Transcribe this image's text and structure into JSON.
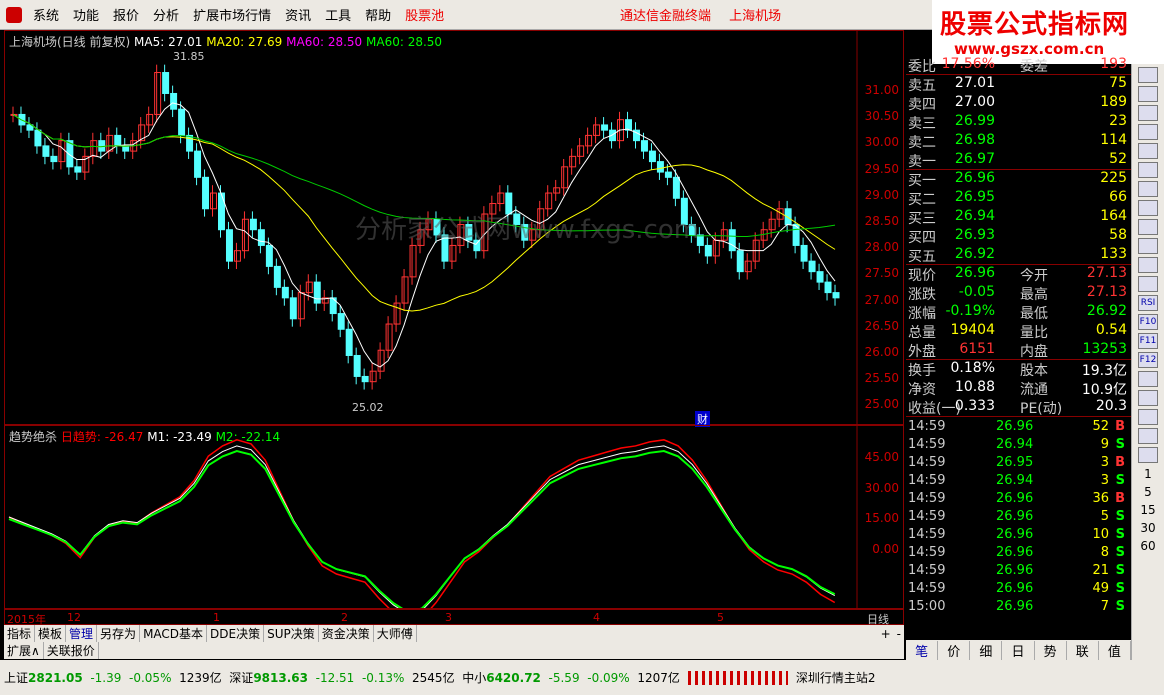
{
  "menu": {
    "items": [
      "系统",
      "功能",
      "报价",
      "分析",
      "扩展市场行情",
      "资讯",
      "工具",
      "帮助"
    ],
    "highlight": "股票池",
    "center_left": "通达信金融终端",
    "center_right": "上海机场"
  },
  "brand": {
    "name": "股票公式指标网",
    "url": "www.gszx.com.cn"
  },
  "chart_title": {
    "stock": "上海机场(日线 前复权)",
    "ma5": "MA5: 27.01",
    "ma20": "MA20: 27.69",
    "ma60a": "MA60: 28.50",
    "ma60b": "MA60: 28.50"
  },
  "price_ticks": [
    "31.00",
    "30.50",
    "30.00",
    "29.50",
    "29.00",
    "28.50",
    "28.00",
    "27.50",
    "27.00",
    "26.50",
    "26.00",
    "25.50",
    "25.00"
  ],
  "annotations": {
    "high": "31.85",
    "low": "25.02",
    "cai": "财"
  },
  "watermark": "分析家公式网www.fxgs.com",
  "indicator": {
    "name": "趋势绝杀",
    "ri": "日趋势: -26.47",
    "m1": "M1: -23.49",
    "m2": "M2: -22.14",
    "ticks": [
      "45.00",
      "30.00",
      "15.00",
      "0.00"
    ]
  },
  "dates": {
    "year": "2015年",
    "d12": "12",
    "d1": "1",
    "d2": "2",
    "d3": "3",
    "d4": "4",
    "d5": "5",
    "period": "日线"
  },
  "tabs1": [
    "指标",
    "模板",
    "管理",
    "另存为",
    "MACD基本",
    "DDE决策",
    "SUP决策",
    "资金决策",
    "大师傅"
  ],
  "tabs2": [
    "扩展∧",
    "关联报价"
  ],
  "quote": {
    "weibi": {
      "label": "委比",
      "value": "17.56%",
      "label2": "委差",
      "value2": "193"
    },
    "sell": [
      {
        "label": "卖五",
        "price": "27.01",
        "vol": "75"
      },
      {
        "label": "卖四",
        "price": "27.00",
        "vol": "189"
      },
      {
        "label": "卖三",
        "price": "26.99",
        "vol": "23"
      },
      {
        "label": "卖二",
        "price": "26.98",
        "vol": "114"
      },
      {
        "label": "卖一",
        "price": "26.97",
        "vol": "52"
      }
    ],
    "buy": [
      {
        "label": "买一",
        "price": "26.96",
        "vol": "225"
      },
      {
        "label": "买二",
        "price": "26.95",
        "vol": "66"
      },
      {
        "label": "买三",
        "price": "26.94",
        "vol": "164"
      },
      {
        "label": "买四",
        "price": "26.93",
        "vol": "58"
      },
      {
        "label": "买五",
        "price": "26.92",
        "vol": "133"
      }
    ],
    "stats": [
      {
        "l1": "现价",
        "v1": "26.96",
        "l2": "今开",
        "v2": "27.13"
      },
      {
        "l1": "涨跌",
        "v1": "-0.05",
        "l2": "最高",
        "v2": "27.13"
      },
      {
        "l1": "涨幅",
        "v1": "-0.19%",
        "l2": "最低",
        "v2": "26.92"
      },
      {
        "l1": "总量",
        "v1": "19404",
        "l2": "量比",
        "v2": "0.54"
      },
      {
        "l1": "外盘",
        "v1": "6151",
        "l2": "内盘",
        "v2": "13253"
      }
    ],
    "stats2": [
      {
        "l1": "换手",
        "v1": "0.18%",
        "l2": "股本",
        "v2": "19.3亿"
      },
      {
        "l1": "净资",
        "v1": "10.88",
        "l2": "流通",
        "v2": "10.9亿"
      },
      {
        "l1": "收益(一)",
        "v1": "0.333",
        "l2": "PE(动)",
        "v2": "20.3"
      }
    ],
    "ticks": [
      {
        "t": "14:59",
        "p": "26.96",
        "v": "52",
        "s": "B"
      },
      {
        "t": "14:59",
        "p": "26.94",
        "v": "9",
        "s": "S"
      },
      {
        "t": "14:59",
        "p": "26.95",
        "v": "3",
        "s": "B"
      },
      {
        "t": "14:59",
        "p": "26.94",
        "v": "3",
        "s": "S"
      },
      {
        "t": "14:59",
        "p": "26.96",
        "v": "36",
        "s": "B"
      },
      {
        "t": "14:59",
        "p": "26.96",
        "v": "5",
        "s": "S"
      },
      {
        "t": "14:59",
        "p": "26.96",
        "v": "10",
        "s": "S"
      },
      {
        "t": "14:59",
        "p": "26.96",
        "v": "8",
        "s": "S"
      },
      {
        "t": "14:59",
        "p": "26.96",
        "v": "21",
        "s": "S"
      },
      {
        "t": "14:59",
        "p": "26.96",
        "v": "49",
        "s": "S"
      },
      {
        "t": "15:00",
        "p": "26.96",
        "v": "7",
        "s": "S"
      }
    ]
  },
  "rtabs": [
    "笔",
    "价",
    "细",
    "日",
    "势",
    "联",
    "值"
  ],
  "sidebar": {
    "buttons": [
      "RSI",
      "F10",
      "F11",
      "F12"
    ],
    "nums": [
      "1",
      "5",
      "15",
      "30",
      "60"
    ]
  },
  "status": {
    "sh": {
      "label": "上证",
      "value": "2821.05",
      "chg": "-1.39",
      "pct": "-0.05%",
      "amt": "1239亿"
    },
    "sz": {
      "label": "深证",
      "value": "9813.63",
      "chg": "-12.51",
      "pct": "-0.13%",
      "amt": "2545亿"
    },
    "zx": {
      "label": "中小",
      "value": "6420.72",
      "chg": "-5.59",
      "pct": "-0.09%",
      "amt": "1207亿"
    },
    "server": "深圳行情主站2"
  }
}
